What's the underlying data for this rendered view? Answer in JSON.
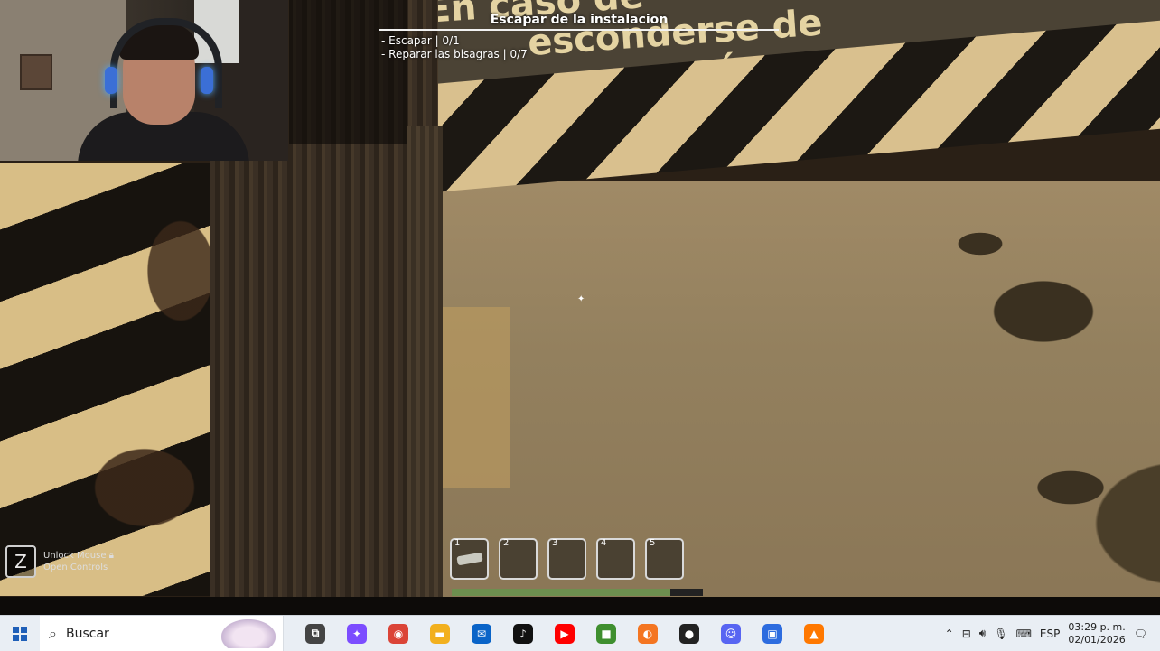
{
  "window": {
    "title": "Escapar de la instalacion"
  },
  "sign": {
    "line1": "En caso de",
    "line2": "esconderse de",
    "line3": "cámara"
  },
  "hud": {
    "objective_title": "Escapar de la instalacion",
    "tasks": [
      {
        "label": "- Escapar | 0/1"
      },
      {
        "label": "- Reparar las bisagras | 0/7"
      }
    ]
  },
  "hint": {
    "key": "Z",
    "line1": "Unlock Mouse",
    "line2": "Open Controls"
  },
  "hotbar": {
    "slots": [
      {
        "num": "1",
        "item": "key-icon"
      },
      {
        "num": "2",
        "item": ""
      },
      {
        "num": "3",
        "item": ""
      },
      {
        "num": "4",
        "item": ""
      },
      {
        "num": "5",
        "item": ""
      }
    ],
    "stamina_fraction": 0.87
  },
  "taskbar": {
    "search_label": "Buscar",
    "apps": [
      {
        "name": "task-view-icon",
        "glyph": "⧉",
        "color": "#444444"
      },
      {
        "name": "copilot-icon",
        "glyph": "✦",
        "color": "#7c4dff"
      },
      {
        "name": "chrome-icon",
        "glyph": "◉",
        "color": "#db4437"
      },
      {
        "name": "file-explorer-icon",
        "glyph": "▬",
        "color": "#f2b01e"
      },
      {
        "name": "outlook-icon",
        "glyph": "✉",
        "color": "#0a64c8"
      },
      {
        "name": "tiktok-icon",
        "glyph": "♪",
        "color": "#111111"
      },
      {
        "name": "youtube-icon",
        "glyph": "▶",
        "color": "#ff0000"
      },
      {
        "name": "minecraft-icon",
        "glyph": "■",
        "color": "#3f8f2f"
      },
      {
        "name": "crunchyroll-icon",
        "glyph": "◐",
        "color": "#f47521"
      },
      {
        "name": "record-app-icon",
        "glyph": "●",
        "color": "#222222"
      },
      {
        "name": "discord-icon",
        "glyph": "☺",
        "color": "#5865f2"
      },
      {
        "name": "bluestacks-icon",
        "glyph": "▣",
        "color": "#2d6cdf"
      },
      {
        "name": "avast-icon",
        "glyph": "▲",
        "color": "#ff7800"
      }
    ],
    "tray": {
      "language": "ESP",
      "time": "03:29 p. m.",
      "date": "02/01/2026"
    }
  }
}
